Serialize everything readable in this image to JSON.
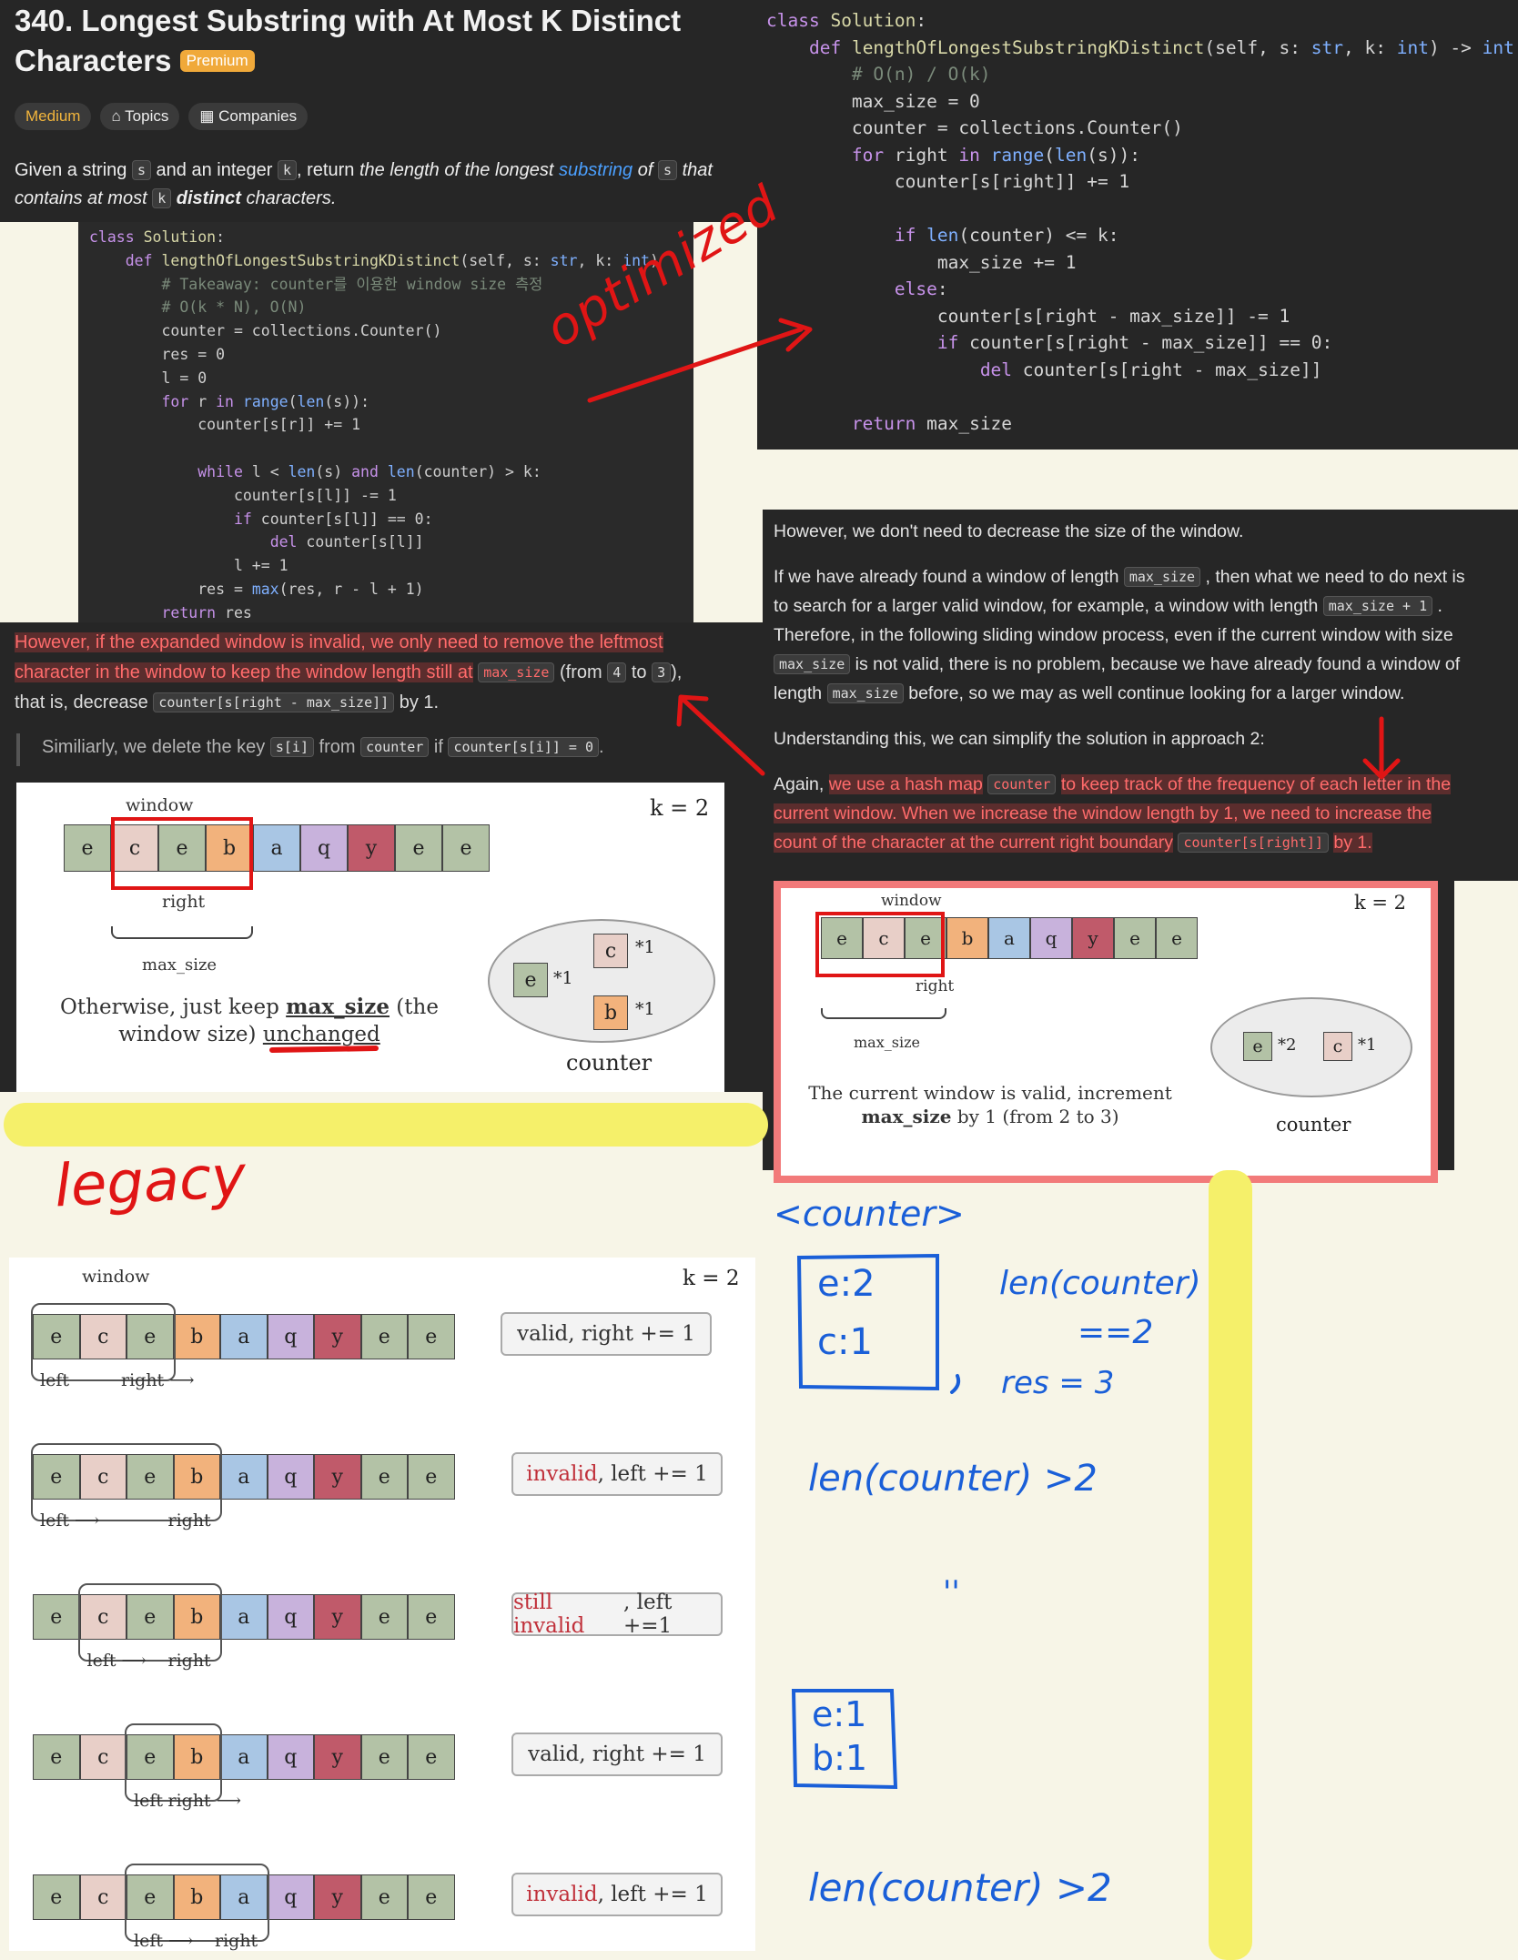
{
  "problem": {
    "number_title": "340. Longest Substring with At Most K Distinct",
    "title_line2": "Characters",
    "premium": "Premium",
    "difficulty": "Medium",
    "topics": "Topics",
    "companies": "Companies",
    "desc_1": "Given a string",
    "desc_s": "s",
    "desc_2": "and an integer",
    "desc_k": "k",
    "desc_3": ", return",
    "desc_4": "the length of the longest",
    "desc_link": "substring",
    "desc_5": "of",
    "desc_6": "that",
    "desc_7": "contains at most",
    "desc_8": "distinct",
    "desc_9": "characters."
  },
  "legacy_code": [
    "class Solution:",
    "    def lengthOfLongestSubstringKDistinct(self, s: str, k: int)",
    "        # Takeaway: counter를 이용한 window size 측정",
    "        # O(k * N), O(N)",
    "        counter = collections.Counter()",
    "        res = 0",
    "        l = 0",
    "        for r in range(len(s)):",
    "            counter[s[r]] += 1",
    "",
    "            while l < len(s) and len(counter) > k:",
    "                counter[s[l]] -= 1",
    "                if counter[s[l]] == 0:",
    "                    del counter[s[l]]",
    "                l += 1",
    "            res = max(res, r - l + 1)",
    "        return res"
  ],
  "optimized_code": [
    "class Solution:",
    "    def lengthOfLongestSubstringKDistinct(self, s: str, k: int) -> int:",
    "        # O(n) / O(k)",
    "        max_size = 0",
    "        counter = collections.Counter()",
    "        for right in range(len(s)):",
    "            counter[s[right]] += 1",
    "",
    "            if len(counter) <= k:",
    "                max_size += 1",
    "            else:",
    "                counter[s[right - max_size]] -= 1",
    "                if counter[s[right - max_size]] == 0:",
    "                    del counter[s[right - max_size]]",
    "",
    "        return max_size"
  ],
  "annotations": {
    "optimized": "optimized",
    "legacy": "legacy"
  },
  "left_expl": {
    "p1a": "However, if the expanded window is invalid, we only need to remove the leftmost",
    "p1b": "character in the window to keep the window length still at",
    "chip_max_size": "max_size",
    "p1c": "(from",
    "chip_4": "4",
    "p1d": "to",
    "chip_3": "3",
    "p1e": "),",
    "p2a": "that is, decrease",
    "chip_expr": "counter[s[right - max_size]]",
    "p2b": "by 1.",
    "q1": "Similiarly, we delete the key",
    "q_chip1": "s[i]",
    "q2": "from",
    "q_chip2": "counter",
    "q3": "if",
    "q_chip3": "counter[s[i]] = 0",
    "q4": "."
  },
  "right_expl": {
    "l1": "However, we don't need to decrease the size of the window.",
    "l2a": "If we have already found a window of length",
    "chip_max_size": "max_size",
    "l2b": ", then what we need to do next is",
    "l3a": "to search for a larger valid window, for example, a window with length",
    "chip_plus": "max_size + 1",
    "l3b": ".",
    "l4": "Therefore, in the following sliding window process, even if the current window with size",
    "l5": "is not valid, there is no problem, because we have already found a window of",
    "l6a": "length",
    "l6b": "before, so we may as well continue looking for a larger window.",
    "l7": "Understanding this, we can simplify the solution in approach 2:",
    "l8a": "Again,",
    "l8b": "we use a hash map",
    "chip_counter": "counter",
    "l8c": "to keep track of the frequency of each letter in the",
    "l9": "current window. When we increase the window length by 1, we need to increase the",
    "l10a": "count of the character at the current right boundary",
    "chip_right": "counter[s[right]]",
    "l10b": "by 1."
  },
  "diagram_left": {
    "window": "window",
    "k": "k = 2",
    "cells": [
      "e",
      "c",
      "e",
      "b",
      "a",
      "q",
      "y",
      "e",
      "e"
    ],
    "right": "right",
    "max_size": "max_size",
    "caption_1": "Otherwise, just keep",
    "caption_bold": "max_size",
    "caption_2": "(the",
    "caption_3": "window size)",
    "caption_under": "unchanged",
    "counter_e": "e",
    "counter_e_count": "*1",
    "counter_c": "c",
    "counter_c_count": "*1",
    "counter_b": "b",
    "counter_b_count": "*1",
    "counter_label": "counter"
  },
  "diagram_right": {
    "window": "window",
    "k": "k = 2",
    "cells": [
      "e",
      "c",
      "e",
      "b",
      "a",
      "q",
      "y",
      "e",
      "e"
    ],
    "right": "right",
    "max_size": "max_size",
    "caption_1": "The current window is valid,  increment",
    "caption_bold": "max_size",
    "caption_2": "by 1 (from 2 to 3)",
    "counter_e": "e",
    "counter_e_count": "*2",
    "counter_c": "c",
    "counter_c_count": "*1",
    "counter_label": "counter"
  },
  "legacy_diagram": {
    "window": "window",
    "k": "k = 2",
    "cells": [
      "e",
      "c",
      "e",
      "b",
      "a",
      "q",
      "y",
      "e",
      "e"
    ],
    "rows": [
      {
        "left": "left",
        "right": "right",
        "note_prefix": "",
        "note": "valid, right += 1"
      },
      {
        "left": "left",
        "right": "right",
        "note_prefix": "invalid",
        "note": ", left += 1"
      },
      {
        "left": "left",
        "right": "right",
        "note_prefix": "still invalid",
        "note": ", left +=1"
      },
      {
        "left": "left",
        "right": "right",
        "note_prefix": "",
        "note": "valid, right += 1"
      },
      {
        "left": "left",
        "right": "right",
        "note_prefix": "invalid",
        "note": ", left += 1"
      }
    ]
  },
  "handwriting": {
    "counter_title": "<counter>",
    "box1_l1": "e:2",
    "box1_l2": "c:1",
    "len_eq": "len(counter)",
    "eq2": "==2",
    "res": "res = 3",
    "len_gt1": "len(counter) >2",
    "ditto": "''",
    "box2_l1": "e:1",
    "box2_l2": "b:1",
    "len_gt2": "len(counter) >2"
  },
  "colors": {
    "green": "#b3c2a6",
    "pink": "#e8cfc8",
    "orange": "#f2b27c",
    "blue": "#a9c6e4",
    "purple": "#c8b2dc",
    "red": "#c05a6a",
    "annotation_red": "#e01515",
    "highlight_yellow": "#f5f06a",
    "pen_blue": "#1a5fd8"
  }
}
